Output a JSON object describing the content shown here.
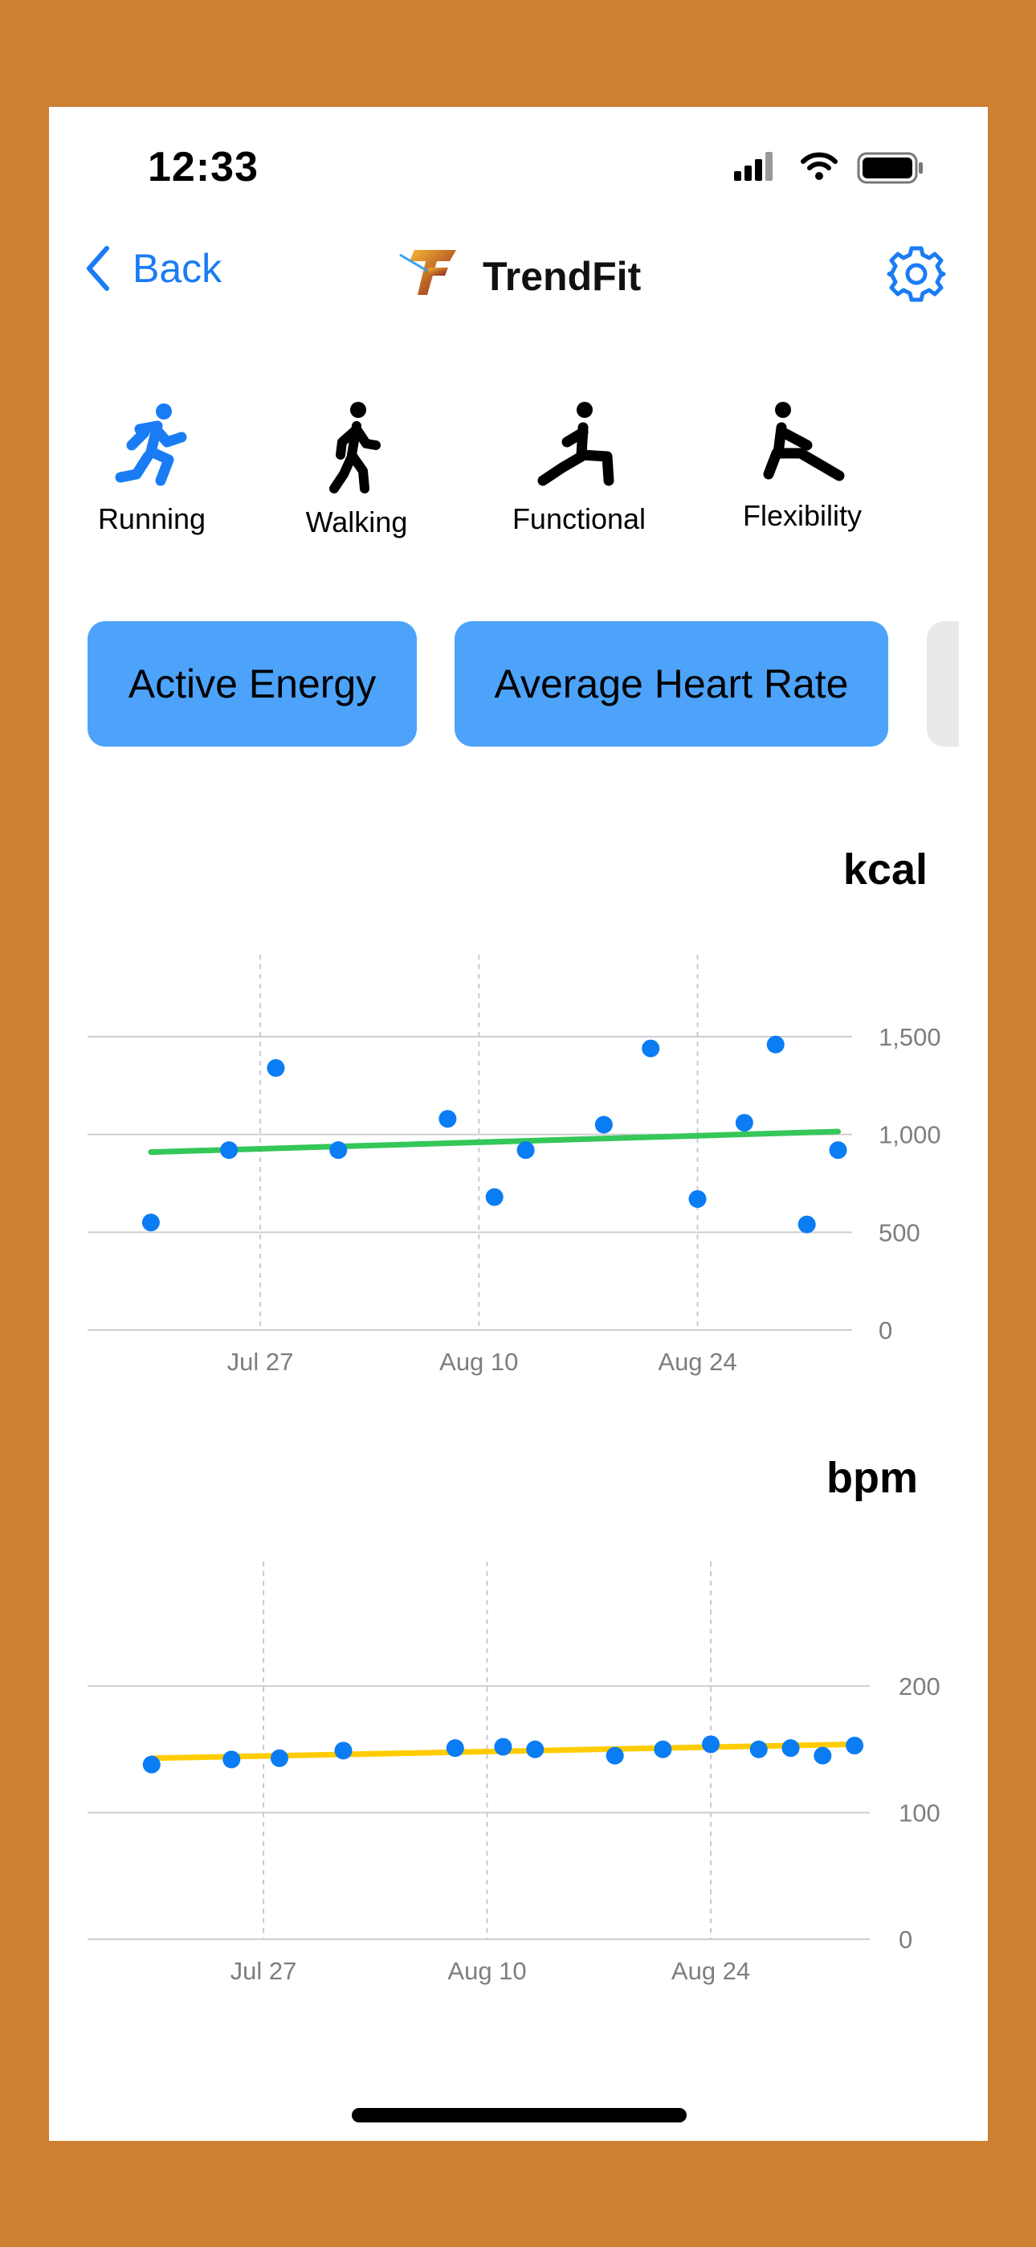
{
  "status_bar": {
    "time": "12:33"
  },
  "nav": {
    "back_label": "Back",
    "title": "TrendFit"
  },
  "activities": [
    {
      "label": "Running",
      "icon": "running-icon",
      "selected": true
    },
    {
      "label": "Walking",
      "icon": "walking-icon",
      "selected": false
    },
    {
      "label": "Functional",
      "icon": "functional-training-icon",
      "selected": false
    },
    {
      "label": "Flexibility",
      "icon": "flexibility-icon",
      "selected": false
    }
  ],
  "metrics": [
    {
      "label": "Active Energy"
    },
    {
      "label": "Average Heart Rate"
    }
  ],
  "colors": {
    "accent": "#1a7cf5",
    "button": "#4da3fa",
    "energy_trend": "#34c759",
    "hr_trend": "#ffcc00",
    "point": "#0a7cf4",
    "frame": "#CD7F32"
  },
  "chart_data": [
    {
      "type": "scatter",
      "unit_label": "kcal",
      "x_ticks": [
        "Jul 27",
        "Aug 10",
        "Aug 24"
      ],
      "x_tick_days": [
        27,
        41,
        55
      ],
      "y_ticks": [
        "0",
        "500",
        "1,000",
        "1,500"
      ],
      "y_tick_values": [
        0,
        500,
        1000,
        1500
      ],
      "ylim": [
        0,
        1500
      ],
      "xlim": [
        18,
        65
      ],
      "series": [
        {
          "points": [
            {
              "x": 20,
              "y": 550
            },
            {
              "x": 25,
              "y": 920
            },
            {
              "x": 28,
              "y": 1340
            },
            {
              "x": 32,
              "y": 920
            },
            {
              "x": 39,
              "y": 1080
            },
            {
              "x": 42,
              "y": 680
            },
            {
              "x": 44,
              "y": 920
            },
            {
              "x": 49,
              "y": 1050
            },
            {
              "x": 52,
              "y": 1440
            },
            {
              "x": 55,
              "y": 670
            },
            {
              "x": 58,
              "y": 1060
            },
            {
              "x": 60,
              "y": 1460
            },
            {
              "x": 62,
              "y": 540
            },
            {
              "x": 64,
              "y": 920
            }
          ]
        }
      ],
      "trend_line": {
        "start": {
          "x": 20,
          "y": 910
        },
        "end": {
          "x": 64,
          "y": 1015
        }
      },
      "grid": true
    },
    {
      "type": "scatter",
      "unit_label": "bpm",
      "x_ticks": [
        "Jul 27",
        "Aug 10",
        "Aug 24"
      ],
      "x_tick_days": [
        27,
        41,
        55
      ],
      "y_ticks": [
        "0",
        "100",
        "200"
      ],
      "y_tick_values": [
        0,
        100,
        200
      ],
      "ylim": [
        0,
        200
      ],
      "xlim": [
        18,
        65
      ],
      "series": [
        {
          "points": [
            {
              "x": 20,
              "y": 138
            },
            {
              "x": 25,
              "y": 142
            },
            {
              "x": 28,
              "y": 143
            },
            {
              "x": 32,
              "y": 149
            },
            {
              "x": 39,
              "y": 151
            },
            {
              "x": 42,
              "y": 152
            },
            {
              "x": 44,
              "y": 150
            },
            {
              "x": 49,
              "y": 145
            },
            {
              "x": 52,
              "y": 150
            },
            {
              "x": 55,
              "y": 154
            },
            {
              "x": 58,
              "y": 150
            },
            {
              "x": 60,
              "y": 151
            },
            {
              "x": 62,
              "y": 145
            },
            {
              "x": 64,
              "y": 153
            }
          ]
        }
      ],
      "trend_line": {
        "start": {
          "x": 20,
          "y": 143
        },
        "end": {
          "x": 64,
          "y": 154
        }
      },
      "grid": true
    }
  ]
}
